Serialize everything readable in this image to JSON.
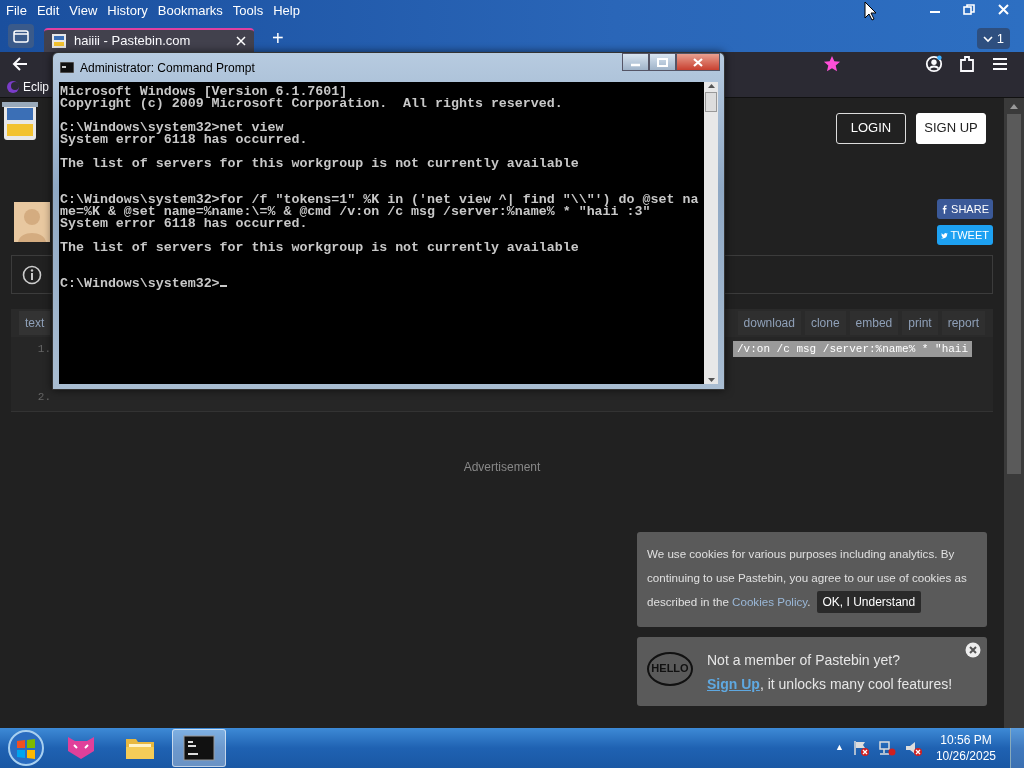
{
  "browser": {
    "menu": [
      "File",
      "Edit",
      "View",
      "History",
      "Bookmarks",
      "Tools",
      "Help"
    ],
    "tabs": [
      {
        "title": "haiiii - Pastebin.com",
        "selected": true
      }
    ],
    "new_tab": "+",
    "tab_count": "1",
    "bookmarks": [
      {
        "label": "Eclip"
      }
    ]
  },
  "page": {
    "buttons": [
      {
        "label": "LOGIN",
        "kind": "outline"
      },
      {
        "label": "SIGN UP",
        "kind": "solid"
      }
    ],
    "share": [
      {
        "label": "SHARE",
        "kind": "facebook"
      },
      {
        "label": "TWEET",
        "kind": "twitter"
      }
    ],
    "toolbar": {
      "left": [
        "text"
      ],
      "right": [
        "download",
        "clone",
        "embed",
        "print",
        "report"
      ]
    },
    "code_lines": [
      {
        "number": "1.",
        "text": "/v:on /c msg /server:%name% * \"haii",
        "selected": true
      },
      {
        "number": "2.",
        "selected": false
      }
    ],
    "advertisement": "Advertisement",
    "cookie": {
      "text": "We use cookies for various purposes including analytics. By continuing to use Pastebin, you agree to our use of cookies as",
      "text_2": "described in the ",
      "link": "Cookies Policy",
      "after": ".",
      "button": "OK, I Understand"
    },
    "signup": {
      "bubble": "HELLO",
      "title": "Not a member of Pastebin yet?",
      "link": "Sign Up",
      "text": ", it unlocks many cool features!"
    }
  },
  "cmd": {
    "title": "Administrator: Command Prompt",
    "sections": [
      {
        "paragraphs": [
          [
            "Microsoft Windows [Version 6.1.7601]",
            "Copyright (c) 2009 Microsoft Corporation.  All rights reserved."
          ],
          [
            "C:\\Windows\\system32>net view",
            "System error 6118 has occurred."
          ],
          [
            "The list of servers for this workgroup is not currently available"
          ]
        ]
      },
      {
        "paragraphs": [
          [
            "C:\\Windows\\system32>for /f \"tokens=1\" %K in ('net view ^| find \"\\\\\"') do @set na",
            "me=%K & @set name=%name:\\=% & @cmd /v:on /c msg /server:%name% * \"haii :3\"",
            "System error 6118 has occurred."
          ],
          [
            "The list of servers for this workgroup is not currently available"
          ]
        ]
      },
      {
        "paragraphs": [
          [
            "C:\\Windows\\system32>"
          ]
        ],
        "cursor": true
      }
    ]
  },
  "taskbar": {
    "apps": [
      {
        "kind": "cat",
        "selected": false
      },
      {
        "kind": "folder",
        "selected": false
      },
      {
        "kind": "console",
        "selected": true
      }
    ],
    "tray_arrow": "▲",
    "time": "10:56 PM",
    "date": "10/26/2025"
  }
}
